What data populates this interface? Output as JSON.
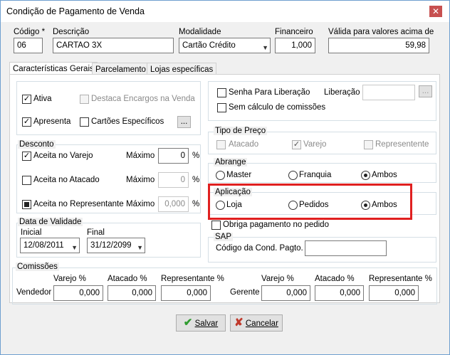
{
  "window": {
    "title": "Condição de Pagamento de Venda",
    "close_glyph": "✕"
  },
  "header": {
    "codigo_label": "Código *",
    "codigo_value": "06",
    "descricao_label": "Descrição",
    "descricao_value": "CARTAO 3X",
    "modalidade_label": "Modalidade",
    "modalidade_value": "Cartão Crédito",
    "financeiro_label": "Financeiro",
    "financeiro_value": "1,000",
    "valida_label": "Válida para valores acima de",
    "valida_value": "59,98"
  },
  "tabs": [
    {
      "label": "Características Gerais"
    },
    {
      "label": "Parcelamento"
    },
    {
      "label": "Lojas específicas"
    }
  ],
  "general": {
    "ativa": {
      "label": "Ativa",
      "checked": true
    },
    "destaca": {
      "label": "Destaca  Encargos na Venda",
      "checked": false
    },
    "apresenta": {
      "label": "Apresenta",
      "checked": true
    },
    "cartoes": {
      "label": "Cartões Específicos",
      "checked": false
    },
    "dots": "..."
  },
  "desconto": {
    "title": "Desconto",
    "rows": [
      {
        "label": "Aceita no Varejo",
        "state": "checked",
        "max_label": "Máximo",
        "value": "0",
        "unit": "%"
      },
      {
        "label": "Aceita no Atacado",
        "state": "unchecked",
        "max_label": "Máximo",
        "value": "0",
        "unit": "%"
      },
      {
        "label": "Aceita no Representante",
        "state": "indeterminate",
        "max_label": "Máximo",
        "value": "0,000",
        "unit": "%"
      }
    ]
  },
  "validade": {
    "title": "Data de Validade",
    "inicial_label": "Inicial",
    "inicial_value": "12/08/2011",
    "final_label": "Final",
    "final_value": "31/12/2099"
  },
  "right": {
    "senha": {
      "label": "Senha Para Liberação",
      "checked": false
    },
    "liberacao_label": "Liberação",
    "sem_calculo": {
      "label": "Sem cálculo de comissões",
      "checked": false
    },
    "tipo_preco": {
      "title": "Tipo de Preço",
      "options": [
        {
          "label": "Atacado",
          "checked": false
        },
        {
          "label": "Varejo",
          "checked": true
        },
        {
          "label": "Representente",
          "checked": false
        }
      ]
    },
    "abrange": {
      "title": "Abrange",
      "options": [
        {
          "label": "Master",
          "selected": false
        },
        {
          "label": "Franquia",
          "selected": false
        },
        {
          "label": "Ambos",
          "selected": true
        }
      ]
    },
    "aplicacao": {
      "title": "Aplicação",
      "options": [
        {
          "label": "Loja",
          "selected": false
        },
        {
          "label": "Pedidos",
          "selected": false
        },
        {
          "label": "Ambos",
          "selected": true
        }
      ]
    },
    "obriga": {
      "label": "Obriga pagamento no pedido",
      "checked": false
    },
    "sap": {
      "title": "SAP",
      "codigo_label": "Código da Cond. Pagto.",
      "codigo_value": ""
    }
  },
  "comissoes": {
    "title": "Comissões",
    "vendedor_label": "Vendedor",
    "gerente_label": "Gerente",
    "headers": [
      "Varejo %",
      "Atacado %",
      "Representante %"
    ],
    "vendedor_values": [
      "0,000",
      "0,000",
      "0,000"
    ],
    "gerente_values": [
      "0,000",
      "0,000",
      "0,000"
    ]
  },
  "footer": {
    "salvar": {
      "label": "Salvar",
      "icon": "check-icon"
    },
    "cancelar": {
      "label": "Cancelar",
      "icon": "x-icon"
    }
  },
  "colors": {
    "highlight": "#e02020",
    "check_green": "#2e9b2e",
    "cancel_red": "#c0392b"
  }
}
